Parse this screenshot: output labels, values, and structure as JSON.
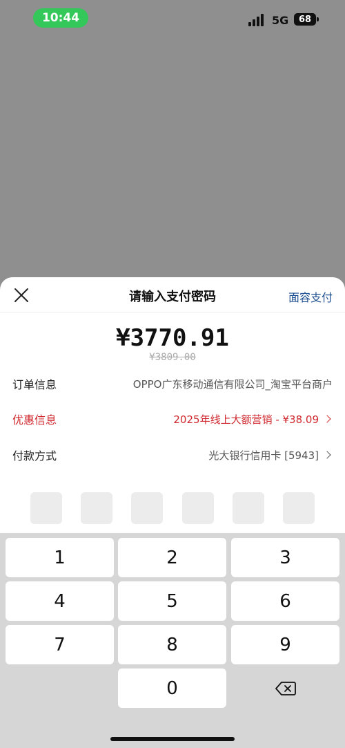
{
  "status": {
    "time": "10:44",
    "network": "5G",
    "battery": "68"
  },
  "header": {
    "title": "请输入支付密码",
    "face_pay": "面容支付"
  },
  "payment": {
    "amount": "¥3770.91",
    "original_amount": "¥3809.00"
  },
  "rows": [
    {
      "label": "订单信息",
      "value": "OPPO广东移动通信有限公司_淘宝平台商户"
    },
    {
      "label": "优惠信息",
      "value": "2025年线上大额营销 - ¥38.09"
    },
    {
      "label": "付款方式",
      "value": "光大银行信用卡 [5943]"
    }
  ],
  "keypad": {
    "keys": [
      "1",
      "2",
      "3",
      "4",
      "5",
      "6",
      "7",
      "8",
      "9",
      "0"
    ]
  },
  "colors": {
    "accent_link": "#1d4f91",
    "discount_red": "#d0282e",
    "time_pill": "#34c759"
  }
}
